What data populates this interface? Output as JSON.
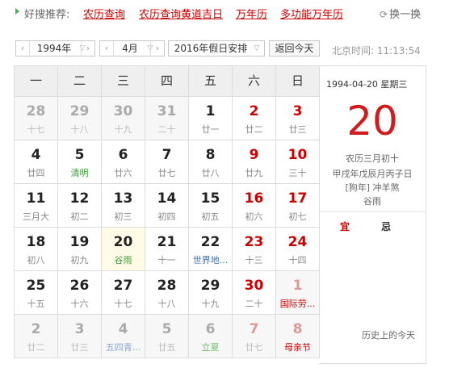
{
  "topbar": {
    "hint": "好搜推荐:",
    "links": [
      "农历查询",
      "农历查询黄道吉日",
      "万年历",
      "多功能万年历"
    ],
    "refresh": "换一换",
    "refresh_icon": "refresh-icon"
  },
  "controls": {
    "year": "1994年",
    "month": "4月",
    "holiday": "2016年假日安排",
    "today_btn": "返回今天",
    "clock": "北京时间: 11:13:54"
  },
  "weekdays": [
    "一",
    "二",
    "三",
    "四",
    "五",
    "六",
    "日"
  ],
  "weeks": [
    [
      {
        "n": "28",
        "s": "十七",
        "other": true
      },
      {
        "n": "29",
        "s": "十八",
        "other": true
      },
      {
        "n": "30",
        "s": "十九",
        "other": true
      },
      {
        "n": "31",
        "s": "二十",
        "other": true
      },
      {
        "n": "1",
        "s": "廿一"
      },
      {
        "n": "2",
        "s": "廿二",
        "we": true
      },
      {
        "n": "3",
        "s": "廿三",
        "we": true
      }
    ],
    [
      {
        "n": "4",
        "s": "廿四"
      },
      {
        "n": "5",
        "s": "清明",
        "c": "green"
      },
      {
        "n": "6",
        "s": "廿六"
      },
      {
        "n": "7",
        "s": "廿七"
      },
      {
        "n": "8",
        "s": "廿八"
      },
      {
        "n": "9",
        "s": "廿九",
        "we": true
      },
      {
        "n": "10",
        "s": "三十",
        "we": true
      }
    ],
    [
      {
        "n": "11",
        "s": "三月大"
      },
      {
        "n": "12",
        "s": "初二"
      },
      {
        "n": "13",
        "s": "初三"
      },
      {
        "n": "14",
        "s": "初四"
      },
      {
        "n": "15",
        "s": "初五"
      },
      {
        "n": "16",
        "s": "初六",
        "we": true
      },
      {
        "n": "17",
        "s": "初七",
        "we": true
      }
    ],
    [
      {
        "n": "18",
        "s": "初八"
      },
      {
        "n": "19",
        "s": "初九"
      },
      {
        "n": "20",
        "s": "谷雨",
        "c": "green",
        "sel": true
      },
      {
        "n": "21",
        "s": "十一"
      },
      {
        "n": "22",
        "s": "世界地...",
        "c": "blue"
      },
      {
        "n": "23",
        "s": "十三",
        "we": true
      },
      {
        "n": "24",
        "s": "十四",
        "we": true
      }
    ],
    [
      {
        "n": "25",
        "s": "十五"
      },
      {
        "n": "26",
        "s": "十六"
      },
      {
        "n": "27",
        "s": "十七"
      },
      {
        "n": "28",
        "s": "十八"
      },
      {
        "n": "29",
        "s": "十九"
      },
      {
        "n": "30",
        "s": "二十",
        "we": true
      },
      {
        "n": "1",
        "s": "国际劳...",
        "c": "red",
        "other": true,
        "we": true,
        "hol": true
      }
    ],
    [
      {
        "n": "2",
        "s": "廿二",
        "other": true
      },
      {
        "n": "3",
        "s": "廿三",
        "other": true
      },
      {
        "n": "4",
        "s": "五四青...",
        "c": "fadeblue",
        "other": true
      },
      {
        "n": "5",
        "s": "廿五",
        "other": true
      },
      {
        "n": "6",
        "s": "立夏",
        "c": "fadegreen",
        "other": true
      },
      {
        "n": "7",
        "s": "廿七",
        "other": true,
        "we": true
      },
      {
        "n": "8",
        "s": "母亲节",
        "c": "red",
        "other": true,
        "we": true
      }
    ]
  ],
  "side": {
    "date": "1994-04-20 星期三",
    "big": "20",
    "lunar": "农历三月初十",
    "ganzhi": "甲戌年戊辰月丙子日",
    "zodiac": "[狗年] 冲羊煞",
    "term": "谷雨",
    "yi": "宜",
    "ji": "忌",
    "history": "历史上的今天"
  }
}
